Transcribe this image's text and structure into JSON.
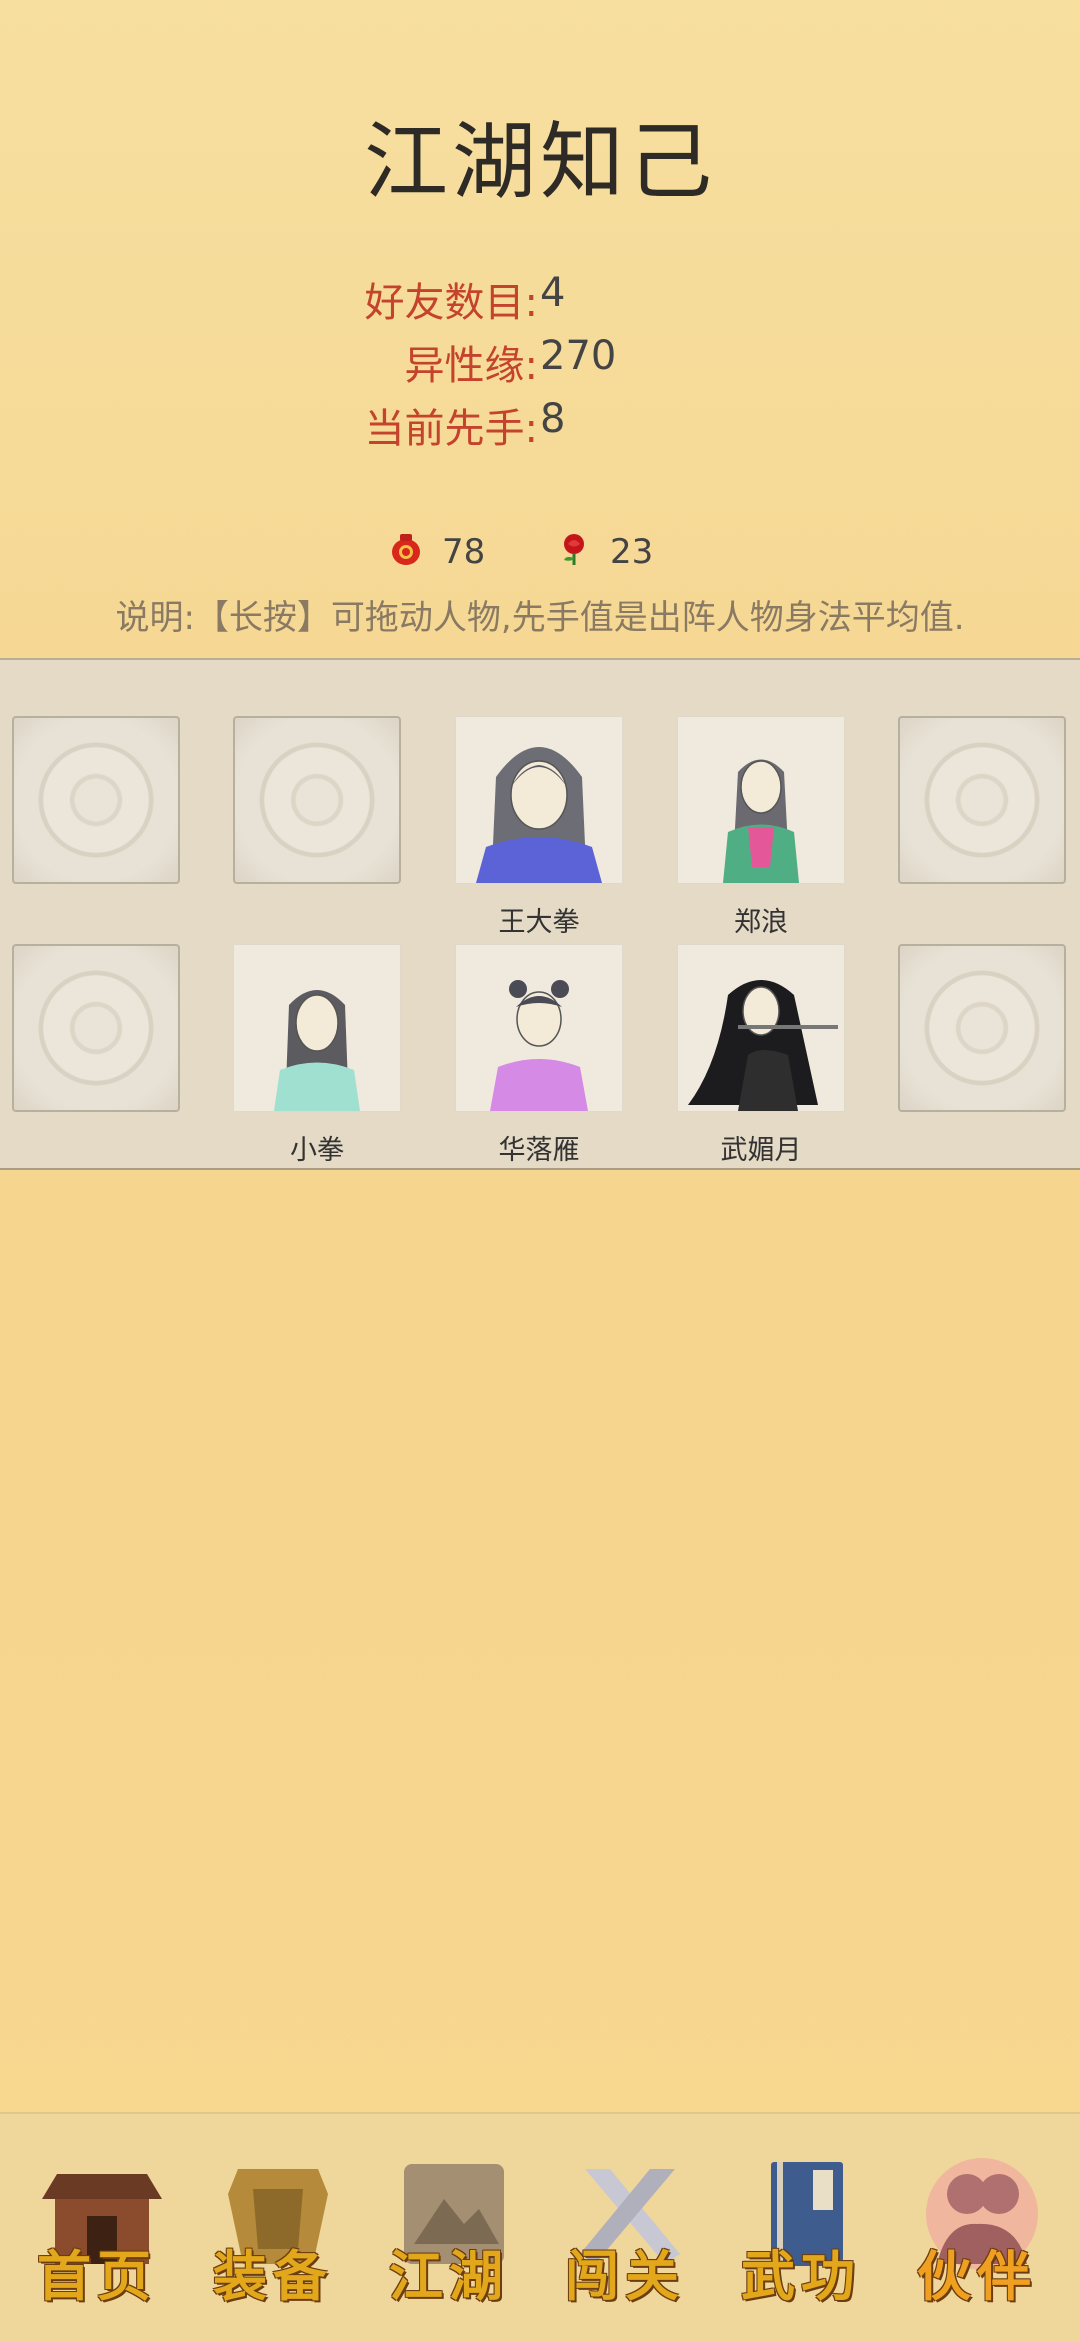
{
  "header": {
    "title": "江湖知己"
  },
  "stats": [
    {
      "label": "好友数目:",
      "value": "4"
    },
    {
      "label": "异性缘:",
      "value": "270"
    },
    {
      "label": "当前先手:",
      "value": "8"
    }
  ],
  "resources": {
    "wine": {
      "icon": "wine-jar-icon",
      "value": "78"
    },
    "rose": {
      "icon": "rose-icon",
      "value": "23"
    }
  },
  "hint": "说明:【长按】可拖动人物,先手值是出阵人物身法平均值.",
  "formation": {
    "row1": [
      {
        "empty": true,
        "name": ""
      },
      {
        "empty": true,
        "name": ""
      },
      {
        "empty": false,
        "name": "王大拳",
        "robe": "#5b63d6"
      },
      {
        "empty": false,
        "name": "郑浪",
        "robe": "#4fae83"
      },
      {
        "empty": true,
        "name": ""
      }
    ],
    "row2": [
      {
        "empty": true,
        "name": ""
      },
      {
        "empty": false,
        "name": "小拳",
        "robe": "#9fe0d0"
      },
      {
        "empty": false,
        "name": "华落雁",
        "robe": "#d58ae6"
      },
      {
        "empty": false,
        "name": "武媚月",
        "robe": "#2e2e2e"
      },
      {
        "empty": true,
        "name": ""
      }
    ]
  },
  "nav": [
    {
      "label": "首页",
      "icon": "house-icon",
      "active": false
    },
    {
      "label": "装备",
      "icon": "armor-icon",
      "active": false
    },
    {
      "label": "江湖",
      "icon": "scroll-map-icon",
      "active": false
    },
    {
      "label": "闯关",
      "icon": "crossed-swords-icon",
      "active": false
    },
    {
      "label": "武功",
      "icon": "book-icon",
      "active": false
    },
    {
      "label": "伙伴",
      "icon": "companions-icon",
      "active": true
    }
  ],
  "colors": {
    "accent": "#c4432c",
    "background": "#f5d58f",
    "panel": "#e4dac6"
  }
}
